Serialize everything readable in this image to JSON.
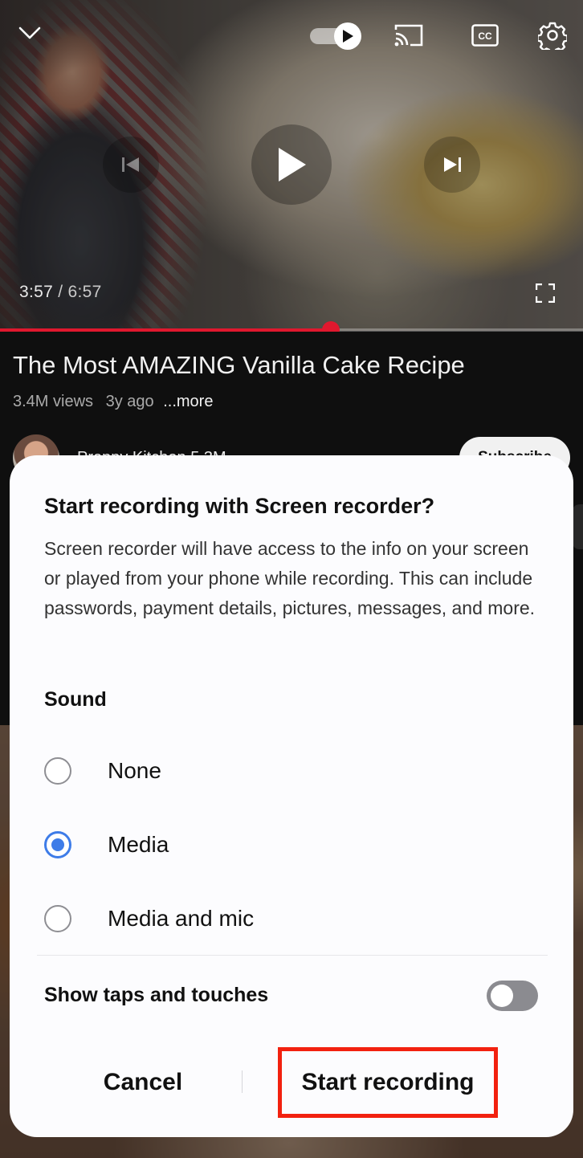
{
  "player": {
    "current_time": "3:57",
    "separator": " / ",
    "duration": "6:57",
    "progress_fraction": 0.567,
    "progress_color": "#e0182e",
    "icons": [
      "chevron-down-icon",
      "autoplay-toggle",
      "cast-icon",
      "closed-captions-icon",
      "settings-gear-icon",
      "previous-icon",
      "play-icon",
      "next-icon",
      "fullscreen-icon"
    ]
  },
  "video": {
    "title": "The Most AMAZING Vanilla Cake Recipe",
    "views": "3.4M views",
    "age": "3y ago",
    "more_label": "...more"
  },
  "channel": {
    "name": "Preppy Kitchen  5.3M",
    "subscribe_label": "Subscribe"
  },
  "dialog": {
    "title": "Start recording with Screen recorder?",
    "body": "Screen recorder will have access to the info on your screen or played from your phone while recording. This can include passwords, payment details, pictures, messages, and more.",
    "sound_label": "Sound",
    "sound_options": [
      {
        "label": "None",
        "selected": false
      },
      {
        "label": "Media",
        "selected": true
      },
      {
        "label": "Media and mic",
        "selected": false
      }
    ],
    "show_taps_label": "Show taps and touches",
    "show_taps_enabled": false,
    "cancel_label": "Cancel",
    "start_label": "Start recording",
    "accent_color": "#3e7ce8",
    "highlight_color": "#f2210f"
  }
}
